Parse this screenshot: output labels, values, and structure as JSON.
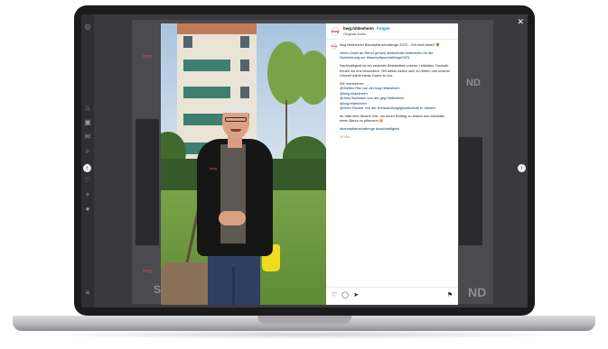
{
  "background_feed": {
    "logo_text": "bwg",
    "heading_fragment_right": "ND",
    "heading_fragment_left": "S"
  },
  "post": {
    "username": "bwg.hildesheim",
    "follow_label": "Folgen",
    "subtitle": "Original-Audio",
    "avatar_text": "bwg",
    "caption_lines": [
      "bwg.hildesheim Baumpflanzchallenge 2023 – Wir sind dabei! 🌳",
      "Vielen Dank an Bernd (privat) @landhotel.hildesheim für die Nominierung zur #baumpflanzchallenge2023.",
      "Nachhaltigkeit ist ein zentraler Bestandteil unserer Leitbildes. Deshalb freuen wir uns besonders, Teil dieser Aktion sein zu dürfen und unserer Umwelt damit etwas Gutes zu tun.",
      "Wir nominieren:",
      "@Steffen Ritz von der bwg Hildesheim",
      "@bwg.hildesheim",
      "@Jens Bollmann von der gbg Hildesheim",
      "@kvg.hildesheim",
      "@Sven Fischer von der Kreissiedlungsgesellschaft in Hameln",
      "Ihr habt eine Woche Zeit, um euren Beitrag zu leisten und ebenfalls einen Baum zu pflanzen! 😊",
      "#baumpflanzchallenge #nachhaltigkeit",
      "10 Wo."
    ]
  },
  "colors": {
    "brand_red": "#c1272d",
    "link_blue": "#0095f6"
  },
  "icons": [
    "close-icon",
    "chevron-left-icon",
    "chevron-right-icon",
    "heart-icon",
    "comment-icon",
    "share-icon",
    "bookmark-icon"
  ]
}
